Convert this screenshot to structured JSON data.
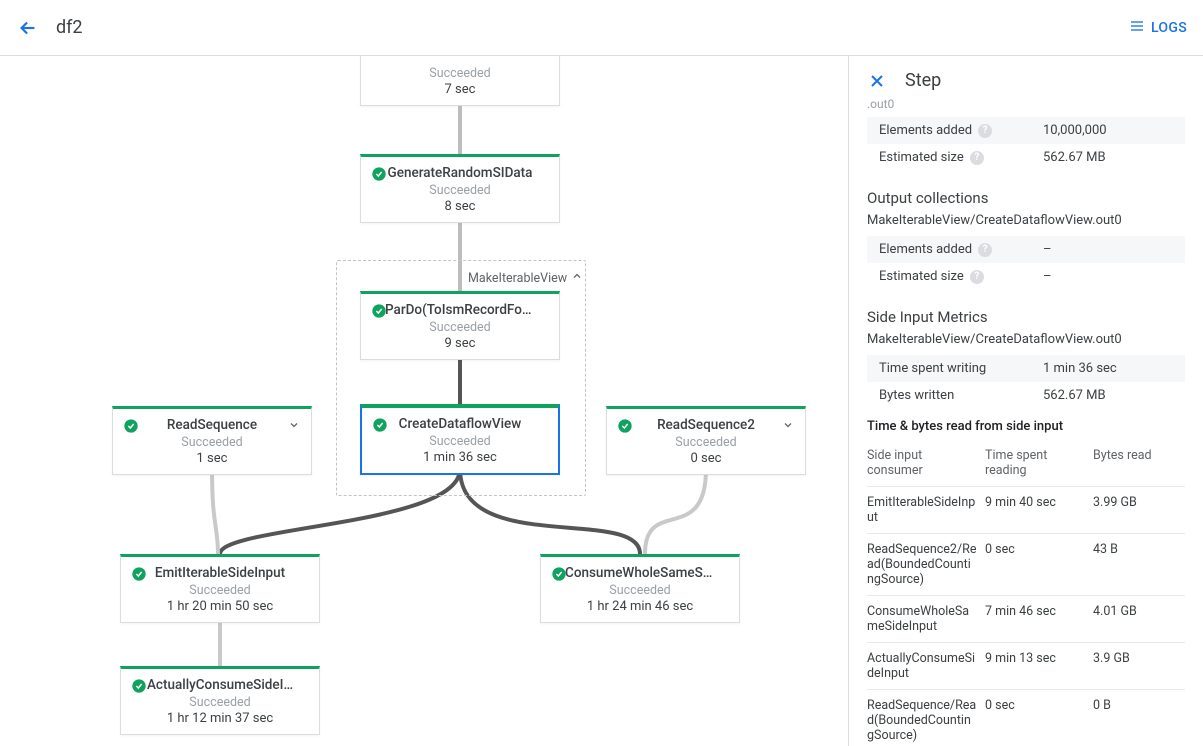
{
  "header": {
    "title": "df2",
    "logs_label": "LOGS"
  },
  "graph": {
    "group_label": "MakeIterableView",
    "nodes": {
      "top_cut": {
        "status": "Succeeded",
        "time": "7 sec"
      },
      "gen": {
        "name": "GenerateRandomSIData",
        "status": "Succeeded",
        "time": "8 sec"
      },
      "pardo": {
        "name": "ParDo(ToIsmRecordFor…",
        "status": "Succeeded",
        "time": "9 sec"
      },
      "create_view": {
        "name": "CreateDataflowView",
        "status": "Succeeded",
        "time": "1 min 36 sec"
      },
      "read_seq": {
        "name": "ReadSequence",
        "status": "Succeeded",
        "time": "1 sec"
      },
      "read_seq2": {
        "name": "ReadSequence2",
        "status": "Succeeded",
        "time": "0 sec"
      },
      "emit": {
        "name": "EmitIterableSideInput",
        "status": "Succeeded",
        "time": "1 hr 20 min 50 sec"
      },
      "consume_whole": {
        "name": "ConsumeWholeSameSi…",
        "status": "Succeeded",
        "time": "1 hr 24 min 46 sec"
      },
      "actually": {
        "name": "ActuallyConsumeSideI…",
        "status": "Succeeded",
        "time": "1 hr 12 min 37 sec"
      }
    }
  },
  "side": {
    "title": "Step",
    "outo": ".out0",
    "input_metrics": [
      {
        "label": "Elements added",
        "value": "10,000,000"
      },
      {
        "label": "Estimated size",
        "value": "562.67 MB"
      }
    ],
    "out_section_title": "Output collections",
    "out_name": "MakeIterableView/CreateDataflowView.out0",
    "output_metrics": [
      {
        "label": "Elements added",
        "value": "–"
      },
      {
        "label": "Estimated size",
        "value": "–"
      }
    ],
    "si_title": "Side Input Metrics",
    "si_name": "MakeIterableView/CreateDataflowView.out0",
    "si_metrics": [
      {
        "label": "Time spent writing",
        "value": "1 min 36 sec"
      },
      {
        "label": "Bytes written",
        "value": "562.67 MB"
      }
    ],
    "si_read_title": "Time & bytes read from side input",
    "si_read_headers": {
      "c1": "Side input consumer",
      "c2": "Time spent reading",
      "c3": "Bytes read"
    },
    "si_read_rows": [
      {
        "consumer": "EmitIterableSideInput",
        "time": "9 min 40 sec",
        "bytes": "3.99 GB"
      },
      {
        "consumer": "ReadSequence2/Read(BoundedCountingSource)",
        "time": "0 sec",
        "bytes": "43 B"
      },
      {
        "consumer": "ConsumeWholeSameSideInput",
        "time": "7 min 46 sec",
        "bytes": "4.01 GB"
      },
      {
        "consumer": "ActuallyConsumeSideInput",
        "time": "9 min 13 sec",
        "bytes": "3.9 GB"
      },
      {
        "consumer": "ReadSequence/Read(BoundedCountingSource)",
        "time": "0 sec",
        "bytes": "0 B"
      }
    ]
  }
}
